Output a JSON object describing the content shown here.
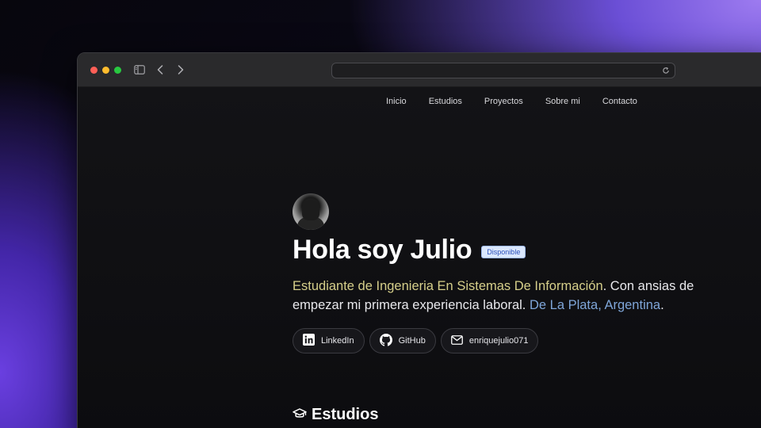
{
  "nav": {
    "items": [
      "Inicio",
      "Estudios",
      "Proyectos",
      "Sobre mi",
      "Contacto"
    ]
  },
  "hero": {
    "title": "Hola soy Julio",
    "badge": "Disponible",
    "bio_highlight": "Estudiante de Ingenieria En Sistemas De Información",
    "bio_middle": ". Con ansias de empezar mi primera experiencia laboral. ",
    "bio_location": "De La Plata, Argentina",
    "bio_end": "."
  },
  "links": {
    "linkedin": "LinkedIn",
    "github": "GitHub",
    "email": "enriquejulio071"
  },
  "section": {
    "title": "Estudios",
    "icon": "graduation-cap-icon"
  },
  "colors": {
    "highlight_yellow": "#d6cf8a",
    "highlight_blue": "#7fa6d9",
    "badge_bg": "#dbe8ff"
  }
}
